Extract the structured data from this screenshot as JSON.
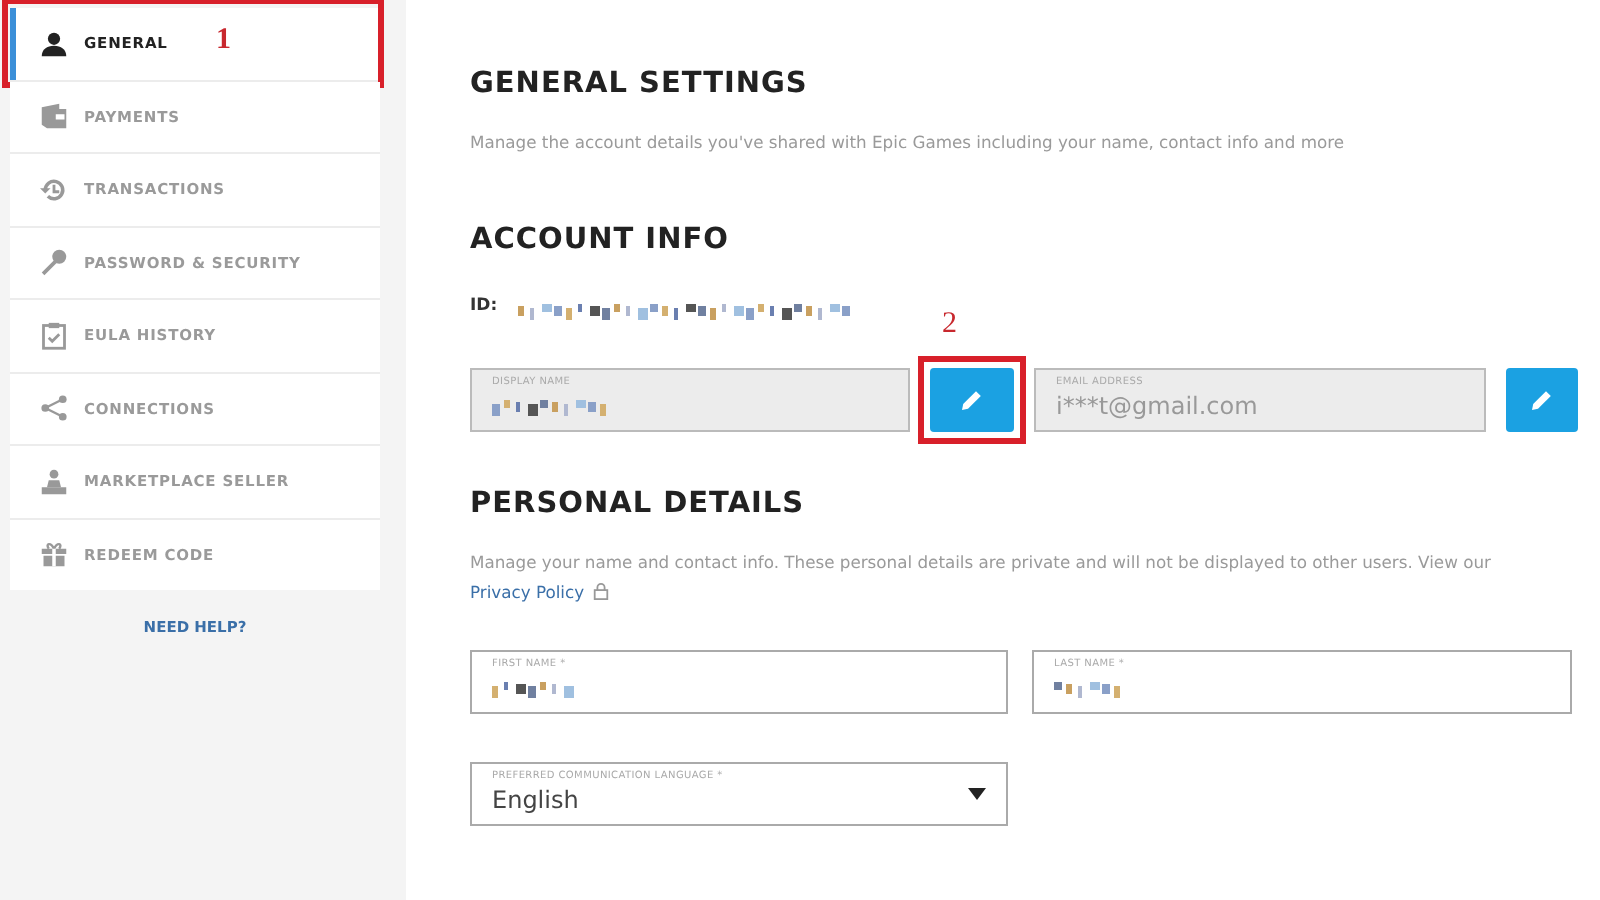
{
  "sidebar": {
    "items": [
      {
        "label": "GENERAL",
        "kind": "person",
        "selected": true,
        "callout": "1"
      },
      {
        "label": "PAYMENTS",
        "kind": "wallet",
        "selected": false
      },
      {
        "label": "TRANSACTIONS",
        "kind": "history",
        "selected": false
      },
      {
        "label": "PASSWORD & SECURITY",
        "kind": "key",
        "selected": false
      },
      {
        "label": "EULA HISTORY",
        "kind": "clipboard",
        "selected": false
      },
      {
        "label": "CONNECTIONS",
        "kind": "share",
        "selected": false
      },
      {
        "label": "MARKETPLACE SELLER",
        "kind": "seller",
        "selected": false
      },
      {
        "label": "REDEEM CODE",
        "kind": "gift",
        "selected": false
      }
    ],
    "help_link": "NEED HELP?"
  },
  "general_settings": {
    "title": "GENERAL SETTINGS",
    "description": "Manage the account details you've shared with Epic Games including your name, contact info and more"
  },
  "account_info": {
    "title": "ACCOUNT INFO",
    "id_label": "ID:",
    "id_redacted": true,
    "fields": [
      {
        "label": "DISPLAY NAME",
        "redacted": true,
        "callout": "2"
      },
      {
        "label": "EMAIL ADDRESS",
        "value": "i***t@gmail.com"
      }
    ]
  },
  "personal_details": {
    "title": "PERSONAL DETAILS",
    "description": "Manage your name and contact info. These personal details are private and will not be displayed to other users. View our",
    "privacy_link": "Privacy Policy",
    "fields": [
      {
        "label": "FIRST NAME *",
        "redacted": true
      },
      {
        "label": "LAST NAME *",
        "redacted": true
      }
    ],
    "language": {
      "label": "PREFERRED COMMUNICATION LANGUAGE *",
      "value": "English"
    }
  }
}
